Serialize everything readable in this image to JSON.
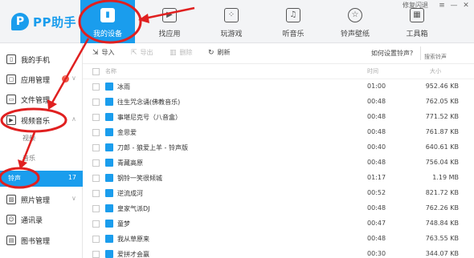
{
  "app": {
    "logo_text": "PP助手",
    "logo_mark": "P",
    "feedback_label": "修复闪退"
  },
  "topnav": [
    {
      "label": "我的设备",
      "icon": "phone-icon",
      "glyph": "▮",
      "active": true
    },
    {
      "label": "找应用",
      "icon": "app-store-icon",
      "glyph": "▶",
      "active": false
    },
    {
      "label": "玩游戏",
      "icon": "gamepad-icon",
      "glyph": "⁘",
      "active": false
    },
    {
      "label": "听音乐",
      "icon": "music-icon",
      "glyph": "♫",
      "active": false
    },
    {
      "label": "铃声壁纸",
      "icon": "star-icon",
      "glyph": "☆",
      "active": false
    },
    {
      "label": "工具箱",
      "icon": "toolbox-icon",
      "glyph": "▦",
      "active": false
    }
  ],
  "sidebar": {
    "items": [
      {
        "label": "我的手机",
        "icon": "phone-icon",
        "glyph": "▯"
      },
      {
        "label": "应用管理",
        "icon": "app-icon",
        "glyph": "▢",
        "badge": "1"
      },
      {
        "label": "文件管理",
        "icon": "folder-icon",
        "glyph": "▭"
      },
      {
        "label": "视频音乐",
        "icon": "video-icon",
        "glyph": "▶"
      },
      {
        "label": "照片管理",
        "icon": "photo-icon",
        "glyph": "▨"
      },
      {
        "label": "通讯录",
        "icon": "contacts-icon",
        "glyph": "☺"
      },
      {
        "label": "图书管理",
        "icon": "book-icon",
        "glyph": "▤"
      }
    ],
    "sub_items": [
      {
        "label": "视频"
      },
      {
        "label": "音乐"
      },
      {
        "label": "铃声",
        "count": "17"
      }
    ]
  },
  "toolbar": {
    "import_label": "导入",
    "export_label": "导出",
    "delete_label": "删除",
    "refresh_label": "刷新",
    "help_label": "如何设置铃声?",
    "search_placeholder": "搜索铃声"
  },
  "table": {
    "columns": {
      "name": "名称",
      "duration": "时间",
      "size": "大小"
    },
    "rows": [
      {
        "name": "冰雨",
        "duration": "01:00",
        "size": "952.46 KB"
      },
      {
        "name": "往生咒念诵(佛教音乐)",
        "duration": "00:48",
        "size": "762.05 KB"
      },
      {
        "name": "事堪尼克号（八音盒）",
        "duration": "00:48",
        "size": "771.52 KB"
      },
      {
        "name": "金思爱",
        "duration": "00:48",
        "size": "761.87 KB"
      },
      {
        "name": "刀郎 - 狼爱上羊 - 铃声版",
        "duration": "00:40",
        "size": "640.61 KB"
      },
      {
        "name": "青藏高原",
        "duration": "00:48",
        "size": "756.04 KB"
      },
      {
        "name": "钢铃一笑很倾城",
        "duration": "01:17",
        "size": "1.19 MB"
      },
      {
        "name": "逆流成河",
        "duration": "00:52",
        "size": "821.72 KB"
      },
      {
        "name": "皇家气派DJ",
        "duration": "00:48",
        "size": "762.26 KB"
      },
      {
        "name": "童梦",
        "duration": "00:47",
        "size": "748.84 KB"
      },
      {
        "name": "我从草原来",
        "duration": "00:48",
        "size": "763.55 KB"
      },
      {
        "name": "爱拼才会赢",
        "duration": "00:30",
        "size": "344.07 KB"
      }
    ]
  },
  "colors": {
    "brand": "#1a9ded",
    "annotation": "#e02020"
  }
}
